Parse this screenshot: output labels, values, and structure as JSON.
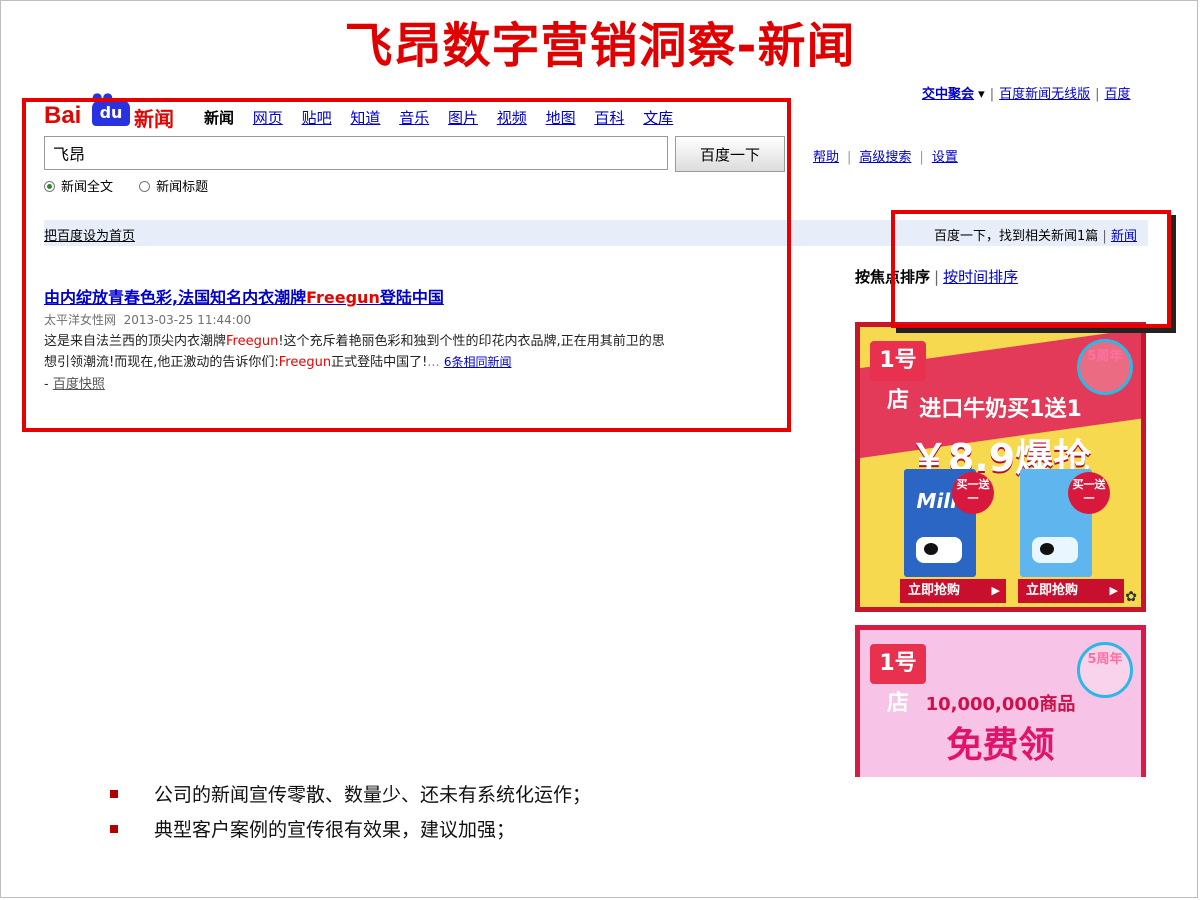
{
  "slide": {
    "title": "飞昂数字营销洞察-新闻",
    "bullets": [
      "公司的新闻宣传零散、数量少、还未有系统化运作；",
      "典型客户案例的宣传很有效果，建议加强；"
    ]
  },
  "logo": {
    "bai": "Bai",
    "du": "du",
    "news": "新闻"
  },
  "nav": {
    "current": "新闻",
    "items": [
      "网页",
      "贴吧",
      "知道",
      "音乐",
      "图片",
      "视频",
      "地图",
      "百科",
      "文库"
    ]
  },
  "top_right": {
    "jiaoju": "交中聚会",
    "wireless": "百度新闻无线版",
    "more": "百度"
  },
  "search": {
    "value": "飞昂",
    "button": "百度一下",
    "help": "帮助",
    "advanced": "高级搜索",
    "settings": "设置"
  },
  "radios": {
    "full": "新闻全文",
    "title": "新闻标题"
  },
  "bar": {
    "left": "把百度设为首页",
    "right_text": "百度一下，找到相关新闻1篇",
    "right_link": "新闻"
  },
  "sort": {
    "focus": "按焦点排序",
    "time": "按时间排序"
  },
  "result": {
    "title_pre": "由内绽放青春色彩,法国知名内衣潮牌",
    "title_hl": "Freegun",
    "title_post": "登陆中国",
    "source": "太平洋女性网",
    "date": "2013-03-25 11:44:00",
    "abs1": "这是来自法兰西的顶尖内衣潮牌",
    "abs_hl1": "Freegun",
    "abs2": "!这个充斥着艳丽色彩和独到个性的印花内衣品牌,正在用其前卫的思想引领潮流!而现在,他正激动的告诉你们:",
    "abs_hl2": "Freegun",
    "abs3": "正式登陆中国了!",
    "dots": "...",
    "more": "6条相同新闻",
    "snapshot": "百度快照"
  },
  "ad1": {
    "brand": "1号店",
    "badge": "5周年",
    "line1": "进口牛奶买1送1",
    "line2": "￥8.9爆抢",
    "carton1": "Milk",
    "burst": "买一送一",
    "button": "立即抢购"
  },
  "ad2": {
    "brand": "1号店",
    "badge": "5周年",
    "line1": "10,000,000商品",
    "line2": "免费领"
  },
  "colors": {
    "title_red": "#e00000",
    "link_blue": "#0000cc",
    "highlight_red": "#e10602",
    "bar_bg": "#e8eef9"
  }
}
